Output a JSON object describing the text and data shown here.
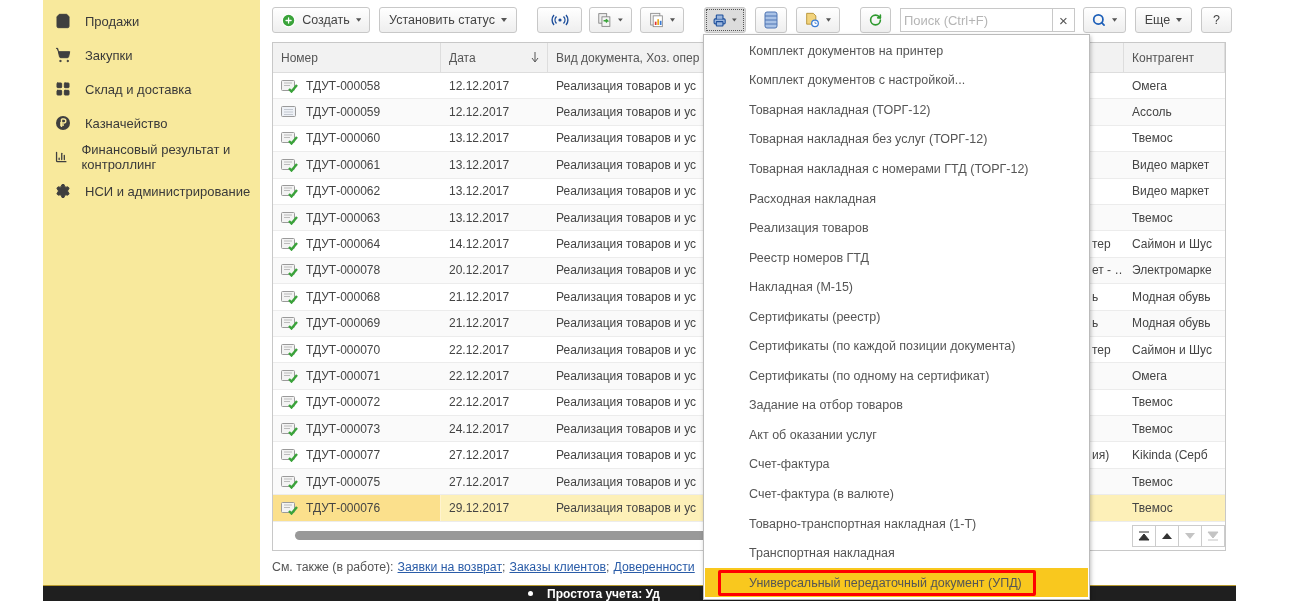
{
  "sidebar": {
    "items": [
      {
        "label": "Продажи",
        "kind": "bag"
      },
      {
        "label": "Закупки",
        "kind": "cart"
      },
      {
        "label": "Склад и доставка",
        "kind": "grid"
      },
      {
        "label": "Казначейство",
        "kind": "coin"
      },
      {
        "label": "Финансовый результат и контроллинг",
        "kind": "chart"
      },
      {
        "label": "НСИ и администрирование",
        "kind": "gear"
      }
    ]
  },
  "toolbar": {
    "buttons": [
      {
        "kind": "create",
        "label": "Создать",
        "dropdown": true,
        "pressed": false
      },
      {
        "kind": "text",
        "label": "Установить статус",
        "dropdown": true,
        "pressed": false
      },
      {
        "kind": "signal",
        "dropdown": false,
        "pressed": false
      },
      {
        "kind": "docs-green",
        "dropdown": true,
        "pressed": false
      },
      {
        "kind": "report",
        "dropdown": true,
        "pressed": false
      },
      {
        "kind": "print",
        "dropdown": true,
        "pressed": true
      },
      {
        "kind": "list",
        "dropdown": false,
        "pressed": false
      },
      {
        "kind": "doc-clock",
        "dropdown": true,
        "pressed": false
      },
      {
        "kind": "refresh",
        "dropdown": false,
        "pressed": false
      },
      {
        "kind": "search-field",
        "placeholder": "Поиск (Ctrl+F)",
        "clear": "×"
      },
      {
        "kind": "search",
        "dropdown": true,
        "pressed": false
      },
      {
        "kind": "text",
        "label": "Еще",
        "dropdown": true,
        "pressed": false
      },
      {
        "kind": "text",
        "label": "?",
        "dropdown": false,
        "pressed": false
      }
    ]
  },
  "table": {
    "columns": {
      "number": {
        "label": "Номер"
      },
      "date": {
        "label": "Дата",
        "sorted_descending": true
      },
      "type": {
        "label": "Вид документа, Хоз. опер"
      },
      "counterparty": {
        "label": "Контрагент"
      }
    },
    "rows": [
      {
        "number": "ТДУТ-000058",
        "date": "12.12.2017",
        "type": "Реализация товаров и ус",
        "counterparty": "Омега",
        "posted": true,
        "selected": false
      },
      {
        "number": "ТДУТ-000059",
        "date": "12.12.2017",
        "type": "Реализация товаров и ус",
        "counterparty": "Ассоль",
        "posted": false,
        "selected": false
      },
      {
        "number": "ТДУТ-000060",
        "date": "13.12.2017",
        "type": "Реализация товаров и ус",
        "counterparty": "Твемос",
        "posted": true,
        "selected": false
      },
      {
        "number": "ТДУТ-000061",
        "date": "13.12.2017",
        "type": "Реализация товаров и ус",
        "counterparty": "Видео маркет",
        "posted": true,
        "selected": false
      },
      {
        "number": "ТДУТ-000062",
        "date": "13.12.2017",
        "type": "Реализация товаров и ус",
        "counterparty": "Видео маркет",
        "posted": true,
        "selected": false
      },
      {
        "number": "ТДУТ-000063",
        "date": "13.12.2017",
        "type": "Реализация товаров и ус",
        "counterparty": "Твемос",
        "posted": true,
        "selected": false
      },
      {
        "number": "ТДУТ-000064",
        "date": "14.12.2017",
        "type": "Реализация товаров и ус",
        "column_4": "тер",
        "counterparty": "Саймон и Шус",
        "posted": true,
        "selected": false
      },
      {
        "number": "ТДУТ-000078",
        "date": "20.12.2017",
        "type": "Реализация товаров и ус",
        "column_4": "ет - …",
        "counterparty": "Электромарке",
        "posted": true,
        "selected": false
      },
      {
        "number": "ТДУТ-000068",
        "date": "21.12.2017",
        "type": "Реализация товаров и ус",
        "column_4": "ь",
        "counterparty": "Модная обувь",
        "posted": true,
        "selected": false
      },
      {
        "number": "ТДУТ-000069",
        "date": "21.12.2017",
        "type": "Реализация товаров и ус",
        "column_4": "ь",
        "counterparty": "Модная обувь",
        "posted": true,
        "selected": false
      },
      {
        "number": "ТДУТ-000070",
        "date": "22.12.2017",
        "type": "Реализация товаров и ус",
        "column_4": "тер",
        "counterparty": "Саймон и Шус",
        "posted": true,
        "selected": false
      },
      {
        "number": "ТДУТ-000071",
        "date": "22.12.2017",
        "type": "Реализация товаров и ус",
        "counterparty": "Омега",
        "posted": true,
        "selected": false
      },
      {
        "number": "ТДУТ-000072",
        "date": "22.12.2017",
        "type": "Реализация товаров и ус",
        "counterparty": "Твемос",
        "posted": true,
        "selected": false
      },
      {
        "number": "ТДУТ-000073",
        "date": "24.12.2017",
        "type": "Реализация товаров и ус",
        "counterparty": "Твемос",
        "posted": true,
        "selected": false
      },
      {
        "number": "ТДУТ-000077",
        "date": "27.12.2017",
        "type": "Реализация товаров и ус",
        "column_4": "ия)",
        "counterparty": "Kikinda (Серб",
        "posted": true,
        "selected": false
      },
      {
        "number": "ТДУТ-000075",
        "date": "27.12.2017",
        "type": "Реализация товаров и ус",
        "counterparty": "Твемос",
        "posted": true,
        "selected": false
      },
      {
        "number": "ТДУТ-000076",
        "date": "29.12.2017",
        "type": "Реализация товаров и ус",
        "counterparty": "Твемос",
        "posted": true,
        "selected": true
      }
    ],
    "nav_buttons": [
      {
        "kind": "first",
        "disabled": false
      },
      {
        "kind": "up",
        "disabled": false
      },
      {
        "kind": "down",
        "disabled": true
      },
      {
        "kind": "last",
        "disabled": true
      }
    ]
  },
  "footer": {
    "prefix": "См. также (в работе):",
    "links": [
      "Заявки на возврат",
      "Заказы клиентов",
      "Доверенности"
    ],
    "separators": [
      ";",
      ";"
    ]
  },
  "print_menu": {
    "items": [
      {
        "label": "Комплект документов на принтер",
        "selected": false,
        "outlined": false
      },
      {
        "label": "Комплект документов с настройкой...",
        "selected": false,
        "outlined": false
      },
      {
        "label": "Товарная накладная (ТОРГ-12)",
        "selected": false,
        "outlined": false
      },
      {
        "label": "Товарная накладная без услуг (ТОРГ-12)",
        "selected": false,
        "outlined": false
      },
      {
        "label": "Товарная накладная с номерами ГТД (ТОРГ-12)",
        "selected": false,
        "outlined": false
      },
      {
        "label": "Расходная накладная",
        "selected": false,
        "outlined": false
      },
      {
        "label": "Реализация товаров",
        "selected": false,
        "outlined": false
      },
      {
        "label": "Реестр номеров ГТД",
        "selected": false,
        "outlined": false
      },
      {
        "label": "Накладная (М-15)",
        "selected": false,
        "outlined": false
      },
      {
        "label": "Сертификаты (реестр)",
        "selected": false,
        "outlined": false
      },
      {
        "label": "Сертификаты (по каждой позиции документа)",
        "selected": false,
        "outlined": false
      },
      {
        "label": "Сертификаты (по одному на сертификат)",
        "selected": false,
        "outlined": false
      },
      {
        "label": "Задание на отбор товаров",
        "selected": false,
        "outlined": false
      },
      {
        "label": "Акт об оказании услуг",
        "selected": false,
        "outlined": false
      },
      {
        "label": "Счет-фактура",
        "selected": false,
        "outlined": false
      },
      {
        "label": "Счет-фактура (в валюте)",
        "selected": false,
        "outlined": false
      },
      {
        "label": "Товарно-транспортная накладная (1-Т)",
        "selected": false,
        "outlined": false
      },
      {
        "label": "Транспортная накладная",
        "selected": false,
        "outlined": false
      },
      {
        "label": "Универсальный передаточный документ (УПД)",
        "selected": true,
        "outlined": true
      }
    ]
  },
  "bottom_bar": {
    "text": "Простота учета: Уд"
  }
}
